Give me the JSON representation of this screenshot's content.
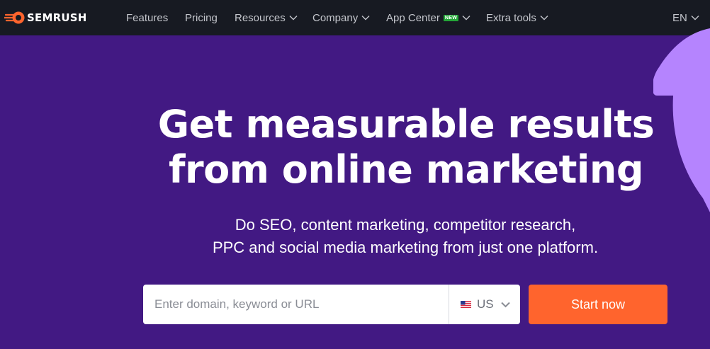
{
  "brand": {
    "name": "SEMRUSH",
    "accent": "#ff642d"
  },
  "nav": {
    "items": [
      {
        "label": "Features",
        "has_dropdown": false
      },
      {
        "label": "Pricing",
        "has_dropdown": false
      },
      {
        "label": "Resources",
        "has_dropdown": true
      },
      {
        "label": "Company",
        "has_dropdown": true
      },
      {
        "label": "App Center",
        "has_dropdown": true,
        "badge": "NEW"
      },
      {
        "label": "Extra tools",
        "has_dropdown": true
      }
    ],
    "language": "EN"
  },
  "hero": {
    "title_line1": "Get measurable results",
    "title_line2": "from online marketing",
    "subtitle_line1": "Do SEO, content marketing, competitor research,",
    "subtitle_line2": "PPC and social media marketing from just one platform."
  },
  "search": {
    "placeholder": "Enter domain, keyword or URL",
    "value": "",
    "country": "US",
    "submit_label": "Start now"
  },
  "colors": {
    "background": "#421983",
    "nav_background": "#171a22",
    "decoration": "#b584fe"
  }
}
